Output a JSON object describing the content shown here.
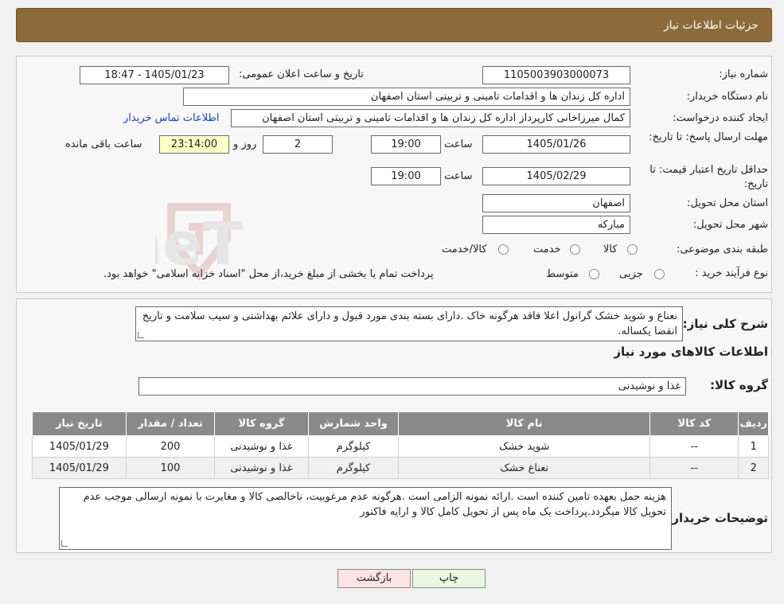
{
  "header": {
    "title": "جزئیات اطلاعات نیاز"
  },
  "info": {
    "need_number_label": "شماره نیاز:",
    "need_number": "1105003903000073",
    "announce_label": "تاریخ و ساعت اعلان عمومی:",
    "announce_value": "1405/01/23 - 18:47",
    "buyer_org_label": "نام دستگاه خریدار:",
    "buyer_org": "اداره کل زندان ها و اقدامات تامینی و تربیتی استان اصفهان",
    "requester_label": "ایجاد کننده درخواست:",
    "requester": "کمال میرزاخانی کارپرداز اداره کل زندان ها و اقدامات تامینی و تربیتی استان اصفهان",
    "contact_link": "اطلاعات تماس خریدار",
    "deadline_label": "مهلت ارسال پاسخ: تا تاریخ:",
    "deadline_date": "1405/01/26",
    "time_label": "ساعت",
    "deadline_time": "19:00",
    "days_value": "2",
    "days_label": "روز و",
    "remaining_time": "23:14:00",
    "remaining_label": "ساعت باقی مانده",
    "validity_label": "حداقل تاریخ اعتبار قیمت: تا تاریخ:",
    "validity_date": "1405/02/29",
    "validity_time": "19:00",
    "province_label": "استان محل تحویل:",
    "province": "اصفهان",
    "city_label": "شهر محل تحویل:",
    "city": "مبارکه",
    "category_label": "طبقه بندی موضوعی:",
    "category_options": [
      "کالا",
      "خدمت",
      "کالا/خدمت"
    ],
    "process_label": "نوع فرآیند خرید :",
    "process_options": [
      "جزیی",
      "متوسط"
    ],
    "process_note": "پرداخت تمام یا بخشی از مبلغ خرید،از محل \"اسناد خزانه اسلامی\" خواهد بود."
  },
  "watermark": "AriaTender.neT",
  "description": {
    "label": "شرح کلی نیاز:",
    "text": "نعناع و شوید خشک گرانول اعلا فاقد هرگونه خاک .دارای بسته بندی مورد قبول و دارای علائم بهداشتی و سیب سلامت و تاریخ انقضا یکساله."
  },
  "goods": {
    "section_title": "اطلاعات کالاهای مورد نیاز",
    "group_label": "گروه کالا:",
    "group_value": "غذا و نوشیدنی",
    "columns": [
      "ردیف",
      "کد کالا",
      "نام کالا",
      "واحد شمارش",
      "گروه کالا",
      "تعداد / مقدار",
      "تاریخ نیاز"
    ],
    "rows": [
      [
        "1",
        "--",
        "شوید خشک",
        "کیلوگرم",
        "غذا و نوشیدنی",
        "200",
        "1405/01/29"
      ],
      [
        "2",
        "--",
        "نعناع خشک",
        "کیلوگرم",
        "غذا و نوشیدنی",
        "100",
        "1405/01/29"
      ]
    ]
  },
  "buyer_notes": {
    "label": "توضیحات خریدار:",
    "text": "هزینه حمل بعهده تامین کننده است .ارائه نمونه الزامی است .هرگونه عدم مرغوبیت، ناخالصی کالا و مغایرت با نمونه ارسالی موجب عدم تحویل کالا میگردد.پرداخت یک ماه پس از تحویل کامل کالا و ارایه فاکتور"
  },
  "buttons": {
    "print": "چاپ",
    "back": "بازگشت"
  },
  "colors": {
    "header": "#8c6a3a",
    "back_button": "#fde3e3",
    "print_button": "#e8f7e0",
    "remaining": "#ffffc6"
  }
}
